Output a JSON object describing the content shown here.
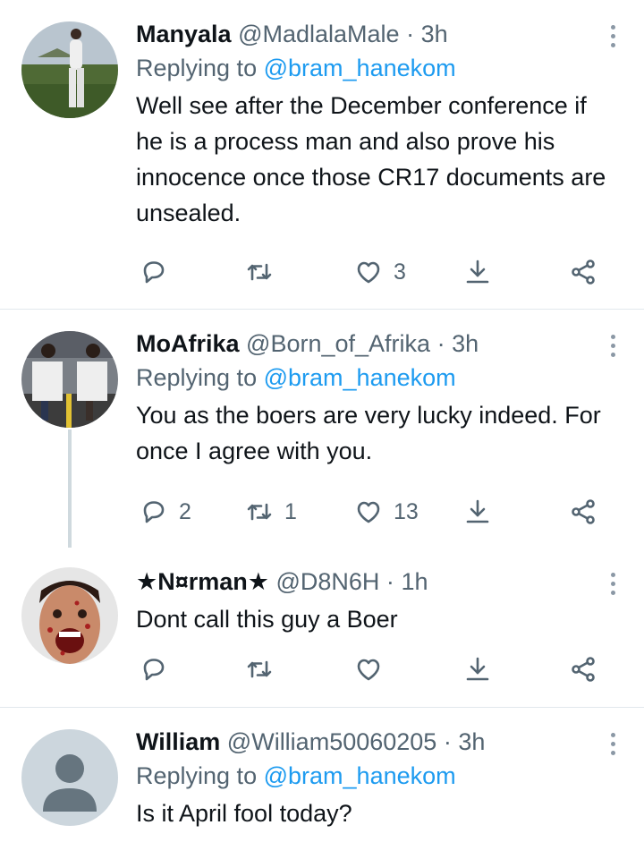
{
  "tweets": [
    {
      "name": "Manyala",
      "handle": "@MadlalaMale",
      "dot": "·",
      "time": "3h",
      "replying_label": "Replying to",
      "replying_to": "@bram_hanekom",
      "text": "Well see after the December conference if he is a process man and also prove his innocence once those CR17 documents are unsealed.",
      "replies": "",
      "retweets": "",
      "likes": "3"
    },
    {
      "name": "MoAfrika",
      "handle": "@Born_of_Afrika",
      "dot": "·",
      "time": "3h",
      "replying_label": "Replying to",
      "replying_to": "@bram_hanekom",
      "text": "You as the boers  are very lucky indeed. For once I agree with you.",
      "replies": "2",
      "retweets": "1",
      "likes": "13"
    },
    {
      "name": "★N¤rman★",
      "handle": "@D8N6H",
      "dot": "·",
      "time": "1h",
      "text": "Dont call this guy a Boer",
      "replies": "",
      "retweets": "",
      "likes": ""
    },
    {
      "name": "William",
      "handle": "@William50060205",
      "dot": "·",
      "time": "3h",
      "replying_label": "Replying to",
      "replying_to": "@bram_hanekom",
      "text": "Is it April fool today?"
    }
  ],
  "icons": {
    "reply": "reply-icon",
    "retweet": "retweet-icon",
    "like": "heart-icon",
    "bookmark": "bookmark-download-icon",
    "share": "share-icon",
    "more": "more-options-icon"
  },
  "colors": {
    "link": "#1d9bf0",
    "secondary_text": "#536471",
    "primary_text": "#0f1419",
    "divider": "#e1e8ed"
  }
}
